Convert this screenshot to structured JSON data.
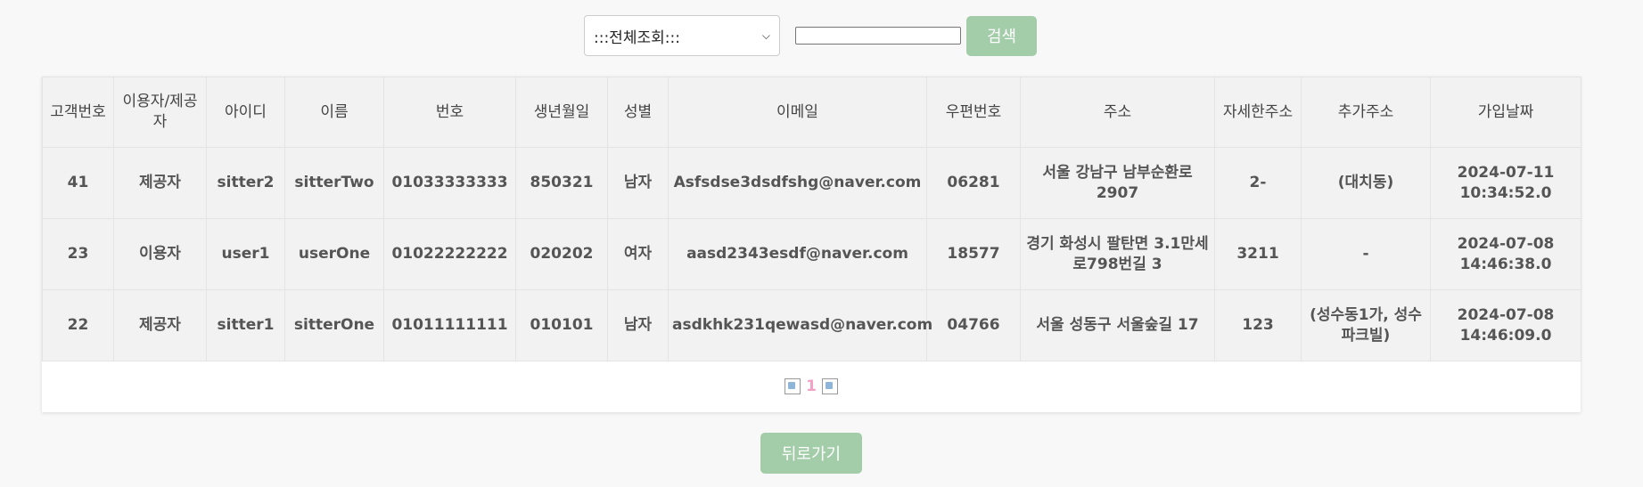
{
  "search": {
    "select_value": ":::전체조회:::",
    "input_value": "",
    "button_label": "검색"
  },
  "table": {
    "headers": [
      "고객번호",
      "이용자/제공자",
      "아이디",
      "이름",
      "번호",
      "생년월일",
      "성별",
      "이메일",
      "우편번호",
      "주소",
      "자세한주소",
      "추가주소",
      "가입날짜"
    ],
    "rows": [
      [
        "41",
        "제공자",
        "sitter2",
        "sitterTwo",
        "01033333333",
        "850321",
        "남자",
        "Asfsdse3dsdfshg@naver.com",
        "06281",
        "서울 강남구 남부순환로 2907",
        "2-",
        "(대치동)",
        "2024-07-11 10:34:52.0"
      ],
      [
        "23",
        "이용자",
        "user1",
        "userOne",
        "01022222222",
        "020202",
        "여자",
        "aasd2343esdf@naver.com",
        "18577",
        "경기 화성시 팔탄면 3.1만세로798번길 3",
        "3211",
        "-",
        "2024-07-08 14:46:38.0"
      ],
      [
        "22",
        "제공자",
        "sitter1",
        "sitterOne",
        "01011111111",
        "010101",
        "남자",
        "asdkhk231qewasd@naver.com",
        "04766",
        "서울 성동구 서울숲길 17",
        "123",
        "(성수동1가, 성수파크빌)",
        "2024-07-08 14:46:09.0"
      ]
    ]
  },
  "pager": {
    "current_page": "1"
  },
  "back_button_label": "뒤로가기",
  "colors": {
    "button_green": "#a3cca9",
    "page_number_pink": "#f2a3c5"
  }
}
